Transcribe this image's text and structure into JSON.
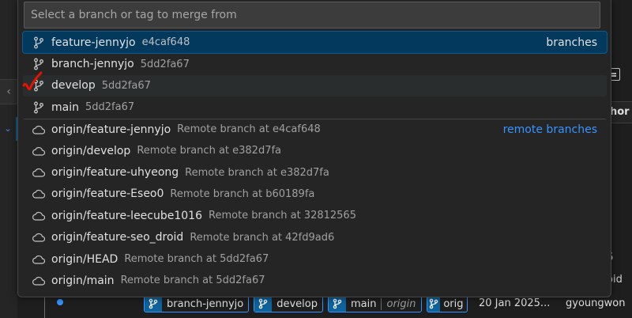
{
  "quick_pick": {
    "placeholder": "Select a branch or tag to merge from",
    "local_group_label": "branches",
    "remote_group_label": "remote branches",
    "items": [
      {
        "label": "feature-jennyjo",
        "description": "e4caf648",
        "icon": "git-branch-icon",
        "state": "active"
      },
      {
        "label": "branch-jennyjo",
        "description": "5dd2fa67",
        "icon": "git-branch-icon",
        "state": ""
      },
      {
        "label": "develop",
        "description": "5dd2fa67",
        "icon": "git-branch-icon",
        "state": "hover"
      },
      {
        "label": "main",
        "description": "5dd2fa67",
        "icon": "git-branch-icon",
        "state": ""
      },
      {
        "label": "origin/feature-jennyjo",
        "description": "Remote branch at e4caf648",
        "icon": "cloud-icon",
        "state": ""
      },
      {
        "label": "origin/develop",
        "description": "Remote branch at e382d7fa",
        "icon": "cloud-icon",
        "state": ""
      },
      {
        "label": "origin/feature-uhyeong",
        "description": "Remote branch at e382d7fa",
        "icon": "cloud-icon",
        "state": ""
      },
      {
        "label": "origin/feature-Eseo0",
        "description": "Remote branch at b60189fa",
        "icon": "cloud-icon",
        "state": ""
      },
      {
        "label": "origin/feature-leecube1016",
        "description": "Remote branch at 32812565",
        "icon": "cloud-icon",
        "state": ""
      },
      {
        "label": "origin/feature-seo_droid",
        "description": "Remote branch at 42fd9ad6",
        "icon": "cloud-icon",
        "state": ""
      },
      {
        "label": "origin/HEAD",
        "description": "Remote branch at 5dd2fa67",
        "icon": "cloud-icon",
        "state": ""
      },
      {
        "label": "origin/main",
        "description": "Remote branch at 5dd2fa67",
        "icon": "cloud-icon",
        "state": ""
      }
    ]
  },
  "background": {
    "right_header": "hor",
    "right_texts": [
      "6",
      "oid"
    ],
    "bottom_tags": [
      {
        "label": "branch-jennyjo",
        "remote": ""
      },
      {
        "label": "develop",
        "remote": ""
      },
      {
        "label": "main",
        "remote": "origin"
      },
      {
        "label": "orig",
        "remote": ""
      }
    ],
    "date": "20 Jan 2025...",
    "author": "gyoungwon"
  },
  "colors": {
    "accent": "#3794ff",
    "active_row": "#04395e",
    "check_mark": "#e51400"
  }
}
